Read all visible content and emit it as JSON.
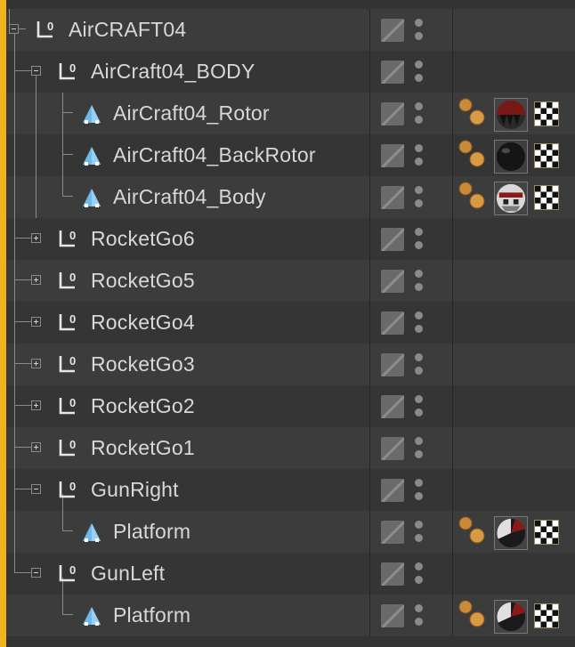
{
  "panel": {
    "accent_color": "#f2b21b",
    "background": "#333333"
  },
  "rows": [
    {
      "label": "AirCRAFT04",
      "type": "null",
      "expander": "open",
      "tags": false
    },
    {
      "label": "AirCraft04_BODY",
      "type": "null",
      "expander": "open",
      "tags": false
    },
    {
      "label": "AirCraft04_Rotor",
      "type": "polygon",
      "expander": "none",
      "tags": true,
      "material": "dark-red"
    },
    {
      "label": "AirCraft04_BackRotor",
      "type": "polygon",
      "expander": "none",
      "tags": true,
      "material": "black"
    },
    {
      "label": "AirCraft04_Body",
      "type": "polygon",
      "expander": "none",
      "tags": true,
      "material": "white-red"
    },
    {
      "label": "RocketGo6",
      "type": "null",
      "expander": "closed",
      "tags": false
    },
    {
      "label": "RocketGo5",
      "type": "null",
      "expander": "closed",
      "tags": false
    },
    {
      "label": "RocketGo4",
      "type": "null",
      "expander": "closed",
      "tags": false
    },
    {
      "label": "RocketGo3",
      "type": "null",
      "expander": "closed",
      "tags": false
    },
    {
      "label": "RocketGo2",
      "type": "null",
      "expander": "closed",
      "tags": false
    },
    {
      "label": "RocketGo1",
      "type": "null",
      "expander": "closed",
      "tags": false
    },
    {
      "label": "GunRight",
      "type": "null",
      "expander": "open",
      "tags": false
    },
    {
      "label": "Platform",
      "type": "polygon",
      "expander": "none",
      "tags": true,
      "material": "mixed"
    },
    {
      "label": "GunLeft",
      "type": "null",
      "expander": "open",
      "tags": false
    },
    {
      "label": "Platform",
      "type": "polygon",
      "expander": "none",
      "tags": true,
      "material": "mixed"
    }
  ],
  "icons": {
    "null_object": "null-object-icon",
    "polygon_object": "polygon-object-icon",
    "visibility_toggle": "layer-checkbox-icon",
    "editor_render_dots": "visibility-dots-icon",
    "phong_tag": "phong-tag-icon",
    "material_tag": "material-tag-icon",
    "texture_tag": "checker-texture-icon"
  }
}
